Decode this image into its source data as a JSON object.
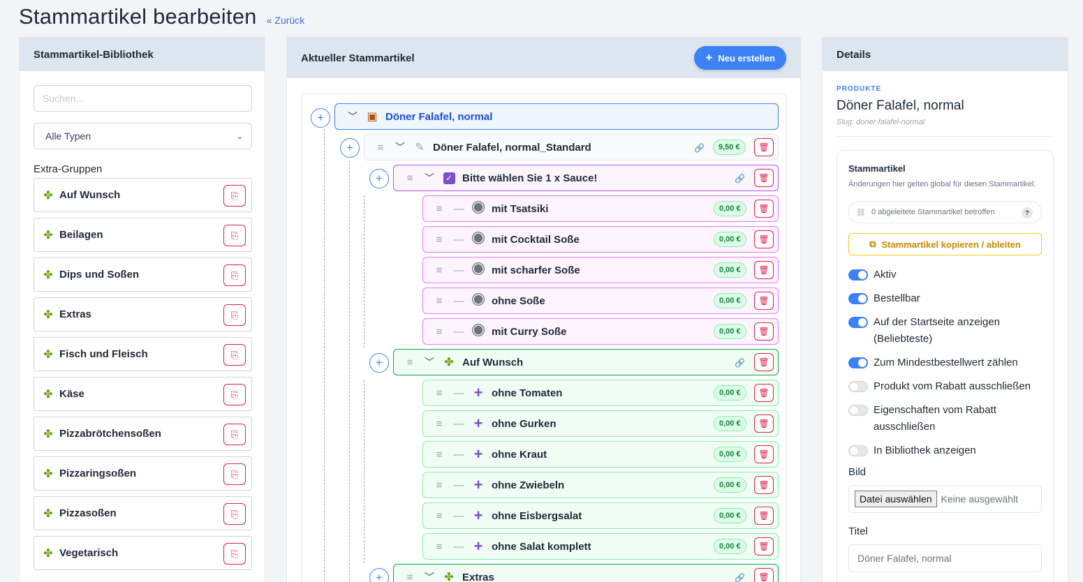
{
  "header": {
    "title": "Stammartikel bearbeiten",
    "back_label": "Zurück"
  },
  "library": {
    "title": "Stammartikel-Bibliothek",
    "search_placeholder": "Suchen...",
    "type_select": "Alle Typen",
    "section_label": "Extra-Gruppen",
    "groups": [
      "Auf Wunsch",
      "Beilagen",
      "Dips und Soßen",
      "Extras",
      "Fisch und Fleisch",
      "Käse",
      "Pizzabrötchensoßen",
      "Pizzaringsoßen",
      "Pizzasoßen",
      "Vegetarisch"
    ]
  },
  "current": {
    "title": "Aktueller Stammartikel",
    "new_button": "Neu erstellen",
    "root": {
      "label": "Döner Falafel, normal"
    },
    "variant": {
      "label": "Döner Falafel, normal_Standard",
      "price": "9,50 €"
    },
    "groups": [
      {
        "label": "Bitte wählen Sie 1 x Sauce!",
        "items": [
          {
            "label": "mit Tsatsiki",
            "price": "0,00 €"
          },
          {
            "label": "mit Cocktail Soße",
            "price": "0,00 €"
          },
          {
            "label": "mit scharfer Soße",
            "price": "0,00 €"
          },
          {
            "label": "ohne Soße",
            "price": "0,00 €"
          },
          {
            "label": "mit Curry Soße",
            "price": "0,00 €"
          }
        ]
      },
      {
        "label": "Auf Wunsch",
        "items": [
          {
            "label": "ohne Tomaten",
            "price": "0,00 €"
          },
          {
            "label": "ohne Gurken",
            "price": "0,00 €"
          },
          {
            "label": "ohne Kraut",
            "price": "0,00 €"
          },
          {
            "label": "ohne Zwiebeln",
            "price": "0,00 €"
          },
          {
            "label": "ohne Eisbergsalat",
            "price": "0,00 €"
          },
          {
            "label": "ohne Salat komplett",
            "price": "0,00 €"
          }
        ]
      },
      {
        "label": "Extras",
        "items": []
      }
    ]
  },
  "details": {
    "title": "Details",
    "product_tag": "PRODUKTE",
    "product_name": "Döner Falafel, normal",
    "slug": "Slug: doner-falafel-normal",
    "stamm_title": "Stammartikel",
    "stamm_sub": "Änderungen hier gelten global für diesen Stammartikel.",
    "derived_text": "0 abgeleitete Stammartikel betroffen",
    "derived_help": "?",
    "copy_button": "Stammartikel kopieren / ableiten",
    "toggles": [
      {
        "label": "Aktiv",
        "on": true
      },
      {
        "label": "Bestellbar",
        "on": true
      },
      {
        "label": "Auf der Startseite anzeigen (Beliebteste)",
        "on": true
      },
      {
        "label": "Zum Mindestbestellwert zählen",
        "on": true
      },
      {
        "label": "Produkt vom Rabatt ausschließen",
        "on": false
      },
      {
        "label": "Eigenschaften vom Rabatt ausschließen",
        "on": false
      },
      {
        "label": "In Bibliothek anzeigen",
        "on": false
      }
    ],
    "image_label": "Bild",
    "file_button": "Datei auswählen",
    "file_status": "Keine ausgewählt",
    "title_label": "Titel",
    "title_value": "Döner Falafel, normal"
  }
}
